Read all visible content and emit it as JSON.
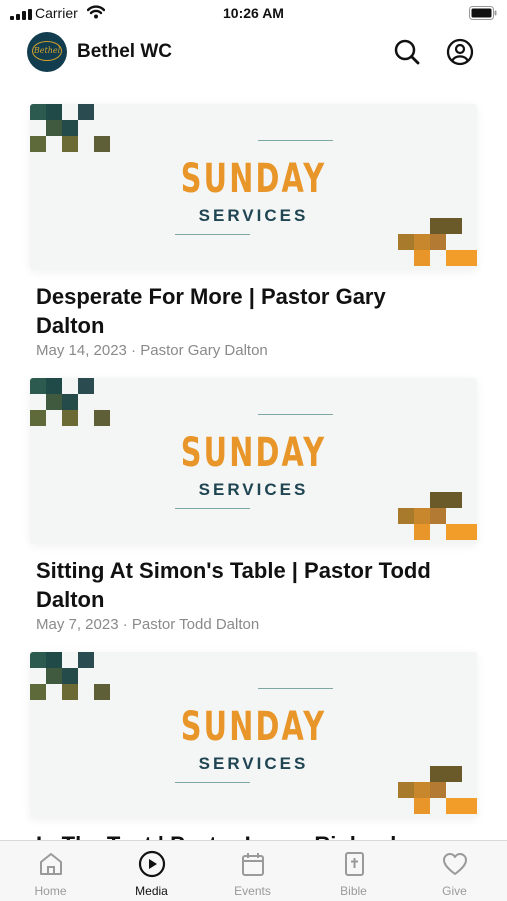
{
  "status_bar": {
    "carrier": "Carrier",
    "time": "10:26 AM"
  },
  "header": {
    "title": "Bethel WC",
    "logo_text": "Bethel"
  },
  "feed": {
    "items": [
      {
        "graphic_title": "SUNDAY",
        "graphic_subtitle": "SERVICES",
        "title": "Desperate For More | Pastor Gary Dalton",
        "date": "May 14, 2023",
        "author": "Pastor Gary Dalton",
        "meta": "May 14, 2023 · Pastor Gary Dalton"
      },
      {
        "graphic_title": "SUNDAY",
        "graphic_subtitle": "SERVICES",
        "title": "Sitting At Simon's Table | Pastor Todd Dalton",
        "date": "May 7, 2023",
        "author": "Pastor Todd Dalton",
        "meta": "May 7, 2023 · Pastor Todd Dalton"
      },
      {
        "graphic_title": "SUNDAY",
        "graphic_subtitle": "SERVICES",
        "title": "In The Tent | Pastor Lucas Rinkerd",
        "date": "",
        "author": "",
        "meta": ""
      }
    ]
  },
  "tab_bar": {
    "active": "Media",
    "tabs": [
      {
        "label": "Home",
        "icon": "home-icon"
      },
      {
        "label": "Media",
        "icon": "play-circle-icon"
      },
      {
        "label": "Events",
        "icon": "calendar-icon"
      },
      {
        "label": "Bible",
        "icon": "bible-icon"
      },
      {
        "label": "Give",
        "icon": "heart-icon"
      }
    ]
  },
  "colors": {
    "accent_orange": "#e8952a",
    "navy": "#1f4452",
    "logo_bg": "#123d4e",
    "logo_gold": "#d4a12c"
  }
}
